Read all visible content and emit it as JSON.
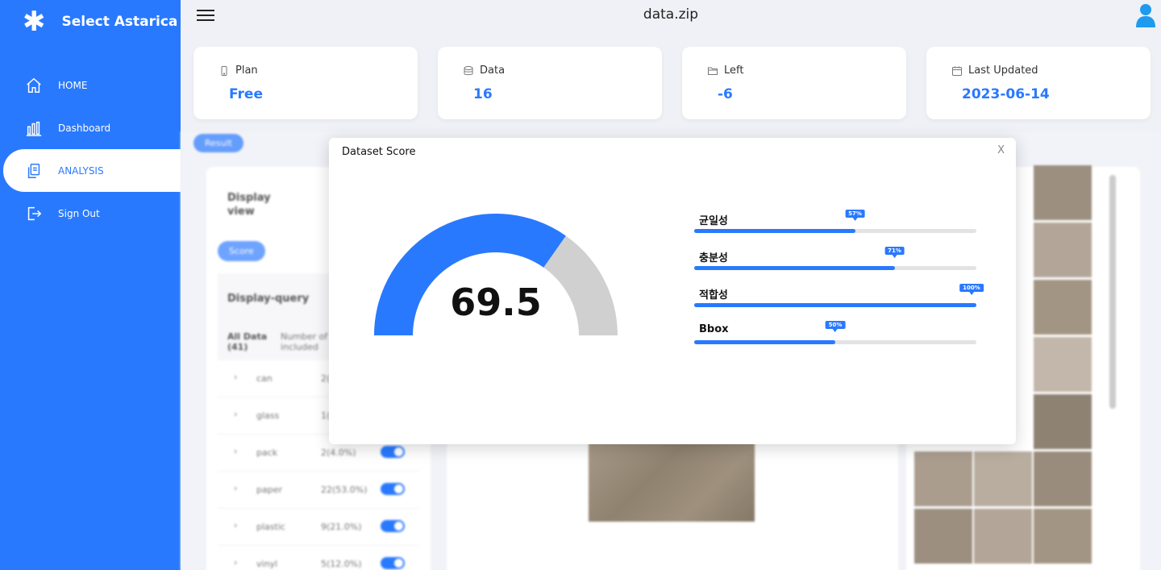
{
  "brand": {
    "title": "Select Astarica",
    "icon": "asterisk-icon"
  },
  "nav": [
    {
      "label": "HOME",
      "icon": "home-icon"
    },
    {
      "label": "Dashboard",
      "icon": "bar-chart-icon"
    },
    {
      "label": "ANALYSIS",
      "icon": "documents-icon",
      "active": true
    },
    {
      "label": "Sign Out",
      "icon": "sign-out-icon"
    }
  ],
  "header": {
    "title": "data.zip"
  },
  "stats": [
    {
      "label": "Plan",
      "value": "Free",
      "icon": "phone-icon"
    },
    {
      "label": "Data",
      "value": "16",
      "icon": "database-icon"
    },
    {
      "label": "Left",
      "value": "-6",
      "icon": "folder-icon"
    },
    {
      "label": "Last Updated",
      "value": "2023-06-14",
      "icon": "calendar-icon"
    }
  ],
  "background": {
    "result_label": "Result",
    "display_view_label": "Display view",
    "score_label": "Score",
    "query_title": "Display-query",
    "col_all": "All Data (41)",
    "col_number": "Number of included",
    "rows": [
      {
        "name": "can",
        "value": "2(",
        "toggle": false
      },
      {
        "name": "glass",
        "value": "1(",
        "toggle": false
      },
      {
        "name": "pack",
        "value": "2(4.0%)",
        "toggle": true
      },
      {
        "name": "paper",
        "value": "22(53.0%)",
        "toggle": true
      },
      {
        "name": "plastic",
        "value": "9(21.0%)",
        "toggle": true
      },
      {
        "name": "vinyl",
        "value": "5(12.0%)",
        "toggle": true
      }
    ]
  },
  "modal": {
    "title": "Dataset Score",
    "close_label": "X",
    "score": "69.5",
    "score_value": 69.5,
    "score_max": 100,
    "bars": [
      {
        "label": "균일성",
        "percent": 57,
        "tip": "57%"
      },
      {
        "label": "충분성",
        "percent": 71,
        "tip": "71%"
      },
      {
        "label": "적합성",
        "percent": 100,
        "tip": "100%"
      },
      {
        "label": "Bbox",
        "percent": 50,
        "tip": "50%"
      }
    ]
  },
  "colors": {
    "accent": "#2979ff",
    "gauge_rest": "#d0d0d0",
    "track": "#e3e3e3"
  }
}
